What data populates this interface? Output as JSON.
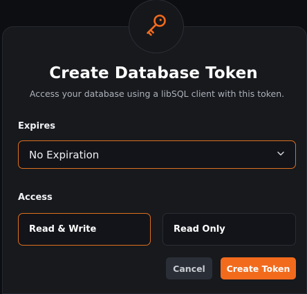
{
  "dialog": {
    "title": "Create Database Token",
    "subtitle": "Access your database using a libSQL client with this token.",
    "icon": "key-icon",
    "accent_color": "#f26b1d"
  },
  "expires": {
    "label": "Expires",
    "selected_value": "No Expiration"
  },
  "access": {
    "label": "Access",
    "options": [
      {
        "label": "Read & Write",
        "selected": true
      },
      {
        "label": "Read Only",
        "selected": false
      }
    ]
  },
  "actions": {
    "cancel_label": "Cancel",
    "create_label": "Create Token"
  }
}
